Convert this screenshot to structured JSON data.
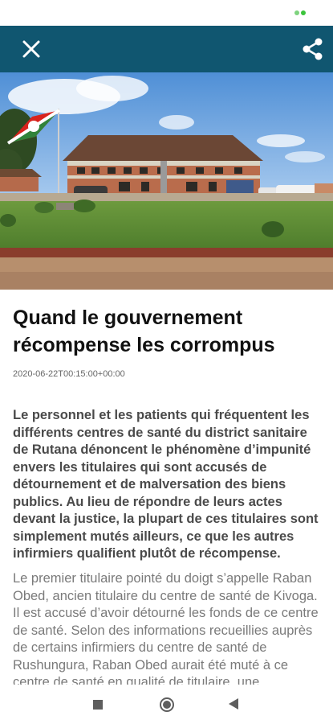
{
  "status_bar": {
    "indicator": "battery-dots"
  },
  "app_bar": {
    "background": "#105670",
    "close_icon": "close-icon",
    "share_icon": "share-icon"
  },
  "hero": {
    "description_icon": "photo"
  },
  "article": {
    "title": "Quand le gouvernement récompense les corrompus",
    "date": "2020-06-22T00:15:00+00:00",
    "lead": "Le personnel et les patients qui fréquentent les différents centres de santé du district sanitaire de Rutana dénoncent le phénomène d’impunité envers les titulaires qui sont accusés de détournement et de malversation des biens publics. Au lieu de répondre de leurs actes devant la justice, la plupart de ces titulaires sont simplement mutés ailleurs, ce que les autres infirmiers qualifient plutôt de récompense.",
    "body": "Le premier titulaire pointé du doigt s’appelle Raban Obed, ancien titulaire du centre de santé de Kivoga. Il est accusé d’avoir détourné les fonds de ce centre de santé. Selon des informations recueillies auprès de certains infirmiers du centre de santé de Rushungura, Raban Obed aurait été muté à ce centre de santé en qualité de titulaire, une"
  },
  "nav_bar": {
    "recent_icon": "square-icon",
    "home_icon": "circle-icon",
    "back_icon": "triangle-back-icon"
  }
}
